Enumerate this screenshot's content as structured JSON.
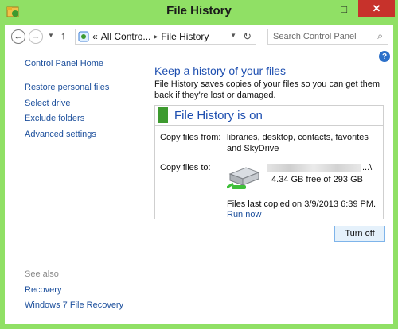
{
  "window": {
    "title": "File History"
  },
  "address": {
    "prefix": "«",
    "crumb1": "All Contro...",
    "separator": "▸",
    "crumb2": "File History"
  },
  "search": {
    "placeholder": "Search Control Panel"
  },
  "nav": {
    "home": "Control Panel Home",
    "items": [
      "Restore personal files",
      "Select drive",
      "Exclude folders",
      "Advanced settings"
    ],
    "see_also_label": "See also",
    "see_also": [
      "Recovery",
      "Windows 7 File Recovery"
    ]
  },
  "content": {
    "title": "Keep a history of your files",
    "description": "File History saves copies of your files so you can get them back if they're lost or damaged.",
    "status": "File History is on",
    "copy_from_label": "Copy files from:",
    "copy_from_value": "libraries, desktop, contacts, favorites and SkyDrive",
    "copy_to_label": "Copy files to:",
    "drive_path_suffix": "...\\",
    "drive_free": "4.34 GB free of 293 GB",
    "last_copied": "Files last copied on 3/9/2013 6:39 PM.",
    "run_now": "Run now",
    "turn_off": "Turn off"
  },
  "colors": {
    "frame": "#90e065",
    "link": "#1c4f9c",
    "title": "#1e4fb0",
    "status": "#3d9a2f",
    "close": "#c7322b"
  }
}
